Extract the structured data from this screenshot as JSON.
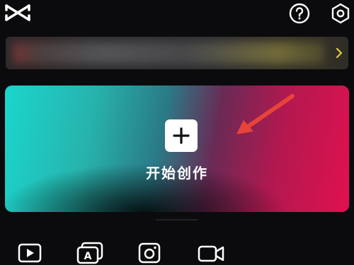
{
  "header": {
    "logo_icon": "capcut-logo-icon",
    "help_icon": "help-circle-icon",
    "settings_icon": "gear-hexagon-icon"
  },
  "banner": {
    "chevron_icon": "chevron-right-icon",
    "chevron_color": "#e8c84a"
  },
  "create_card": {
    "button_icon": "plus-icon",
    "label": "开始创作",
    "annotation_arrow_color": "#e8433a"
  },
  "tools": [
    {
      "icon": "video-play-icon"
    },
    {
      "icon": "template-a-icon"
    },
    {
      "icon": "camera-photo-icon"
    },
    {
      "icon": "video-camera-icon"
    }
  ],
  "colors": {
    "background": "#0b0b0d",
    "gradient_left": "#1ad6cc",
    "gradient_right": "#e0114f"
  }
}
